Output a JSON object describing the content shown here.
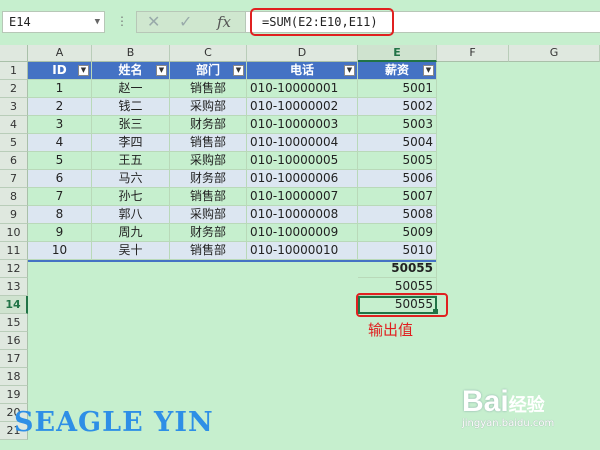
{
  "name_box": {
    "value": "E14",
    "dropdown_icon": "chevron-down-icon"
  },
  "formula_bar": {
    "overflow_dots": "⋮",
    "cancel_icon": "close-icon",
    "enter_icon": "check-icon",
    "fx_label": "fx",
    "formula": "=SUM(E2:E10,E11)"
  },
  "columns": [
    "A",
    "B",
    "C",
    "D",
    "E",
    "F",
    "G"
  ],
  "active_column": "E",
  "rows": [
    "1",
    "2",
    "3",
    "4",
    "5",
    "6",
    "7",
    "8",
    "9",
    "10",
    "11",
    "12",
    "13",
    "14",
    "15",
    "16",
    "17",
    "18",
    "19",
    "20",
    "21"
  ],
  "active_row": "14",
  "table_headers": [
    "ID",
    "姓名",
    "部门",
    "电话",
    "薪资"
  ],
  "filter_icon": "filter-dropdown-icon",
  "table_rows": [
    [
      "1",
      "赵一",
      "销售部",
      "010-10000001",
      "5001"
    ],
    [
      "2",
      "钱二",
      "采购部",
      "010-10000002",
      "5002"
    ],
    [
      "3",
      "张三",
      "财务部",
      "010-10000003",
      "5003"
    ],
    [
      "4",
      "李四",
      "销售部",
      "010-10000004",
      "5004"
    ],
    [
      "5",
      "王五",
      "采购部",
      "010-10000005",
      "5005"
    ],
    [
      "6",
      "马六",
      "财务部",
      "010-10000006",
      "5006"
    ],
    [
      "7",
      "孙七",
      "销售部",
      "010-10000007",
      "5007"
    ],
    [
      "8",
      "郭八",
      "采购部",
      "010-10000008",
      "5008"
    ],
    [
      "9",
      "周九",
      "财务部",
      "010-10000009",
      "5009"
    ],
    [
      "10",
      "吴十",
      "销售部",
      "010-10000010",
      "5010"
    ]
  ],
  "extra_cells": {
    "E12": "50055",
    "E13": "50055",
    "E14": "50055"
  },
  "annotation": "输出值",
  "watermark_text": "SEAGLE YIN",
  "baidu_logo": {
    "text": "Bai",
    "suffix": "经验",
    "url": "jingyan.baidu.com"
  },
  "colors": {
    "header_blue": "#4472c4",
    "band_blue": "#dce6f1",
    "sheet_green": "#c6efce",
    "annotation_red": "#e02020",
    "selection_green": "#217346"
  }
}
